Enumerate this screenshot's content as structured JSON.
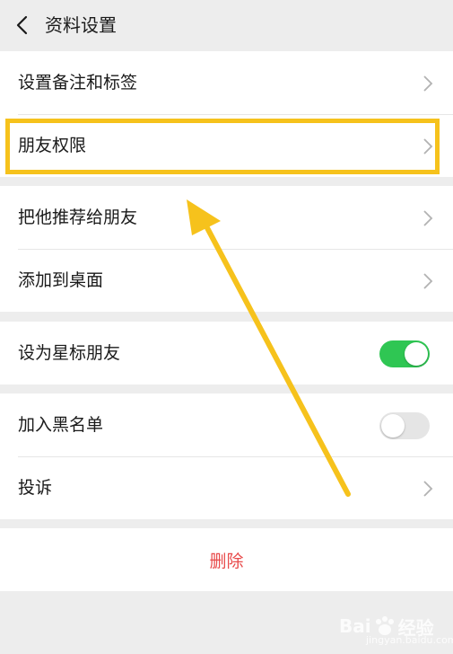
{
  "header": {
    "title": "资料设置",
    "back_icon": "chevron-left-icon"
  },
  "group1": {
    "items": [
      {
        "label": "设置备注和标签"
      },
      {
        "label": "朋友权限"
      }
    ]
  },
  "group2": {
    "items": [
      {
        "label": "把他推荐给朋友"
      },
      {
        "label": "添加到桌面"
      }
    ]
  },
  "group3": {
    "items": [
      {
        "label": "设为星标朋友",
        "toggle": "on"
      }
    ]
  },
  "group4": {
    "items": [
      {
        "label": "加入黑名单",
        "toggle": "off"
      },
      {
        "label": "投诉"
      }
    ]
  },
  "delete": {
    "label": "删除"
  },
  "watermark": {
    "brand": "Bai",
    "brand2": "经验",
    "sub": "jingyan.baidu.com"
  },
  "colors": {
    "accent_green": "#2fc653",
    "delete_red": "#e84a4a",
    "highlight_yellow": "#f6c21c",
    "background": "#ededed"
  }
}
